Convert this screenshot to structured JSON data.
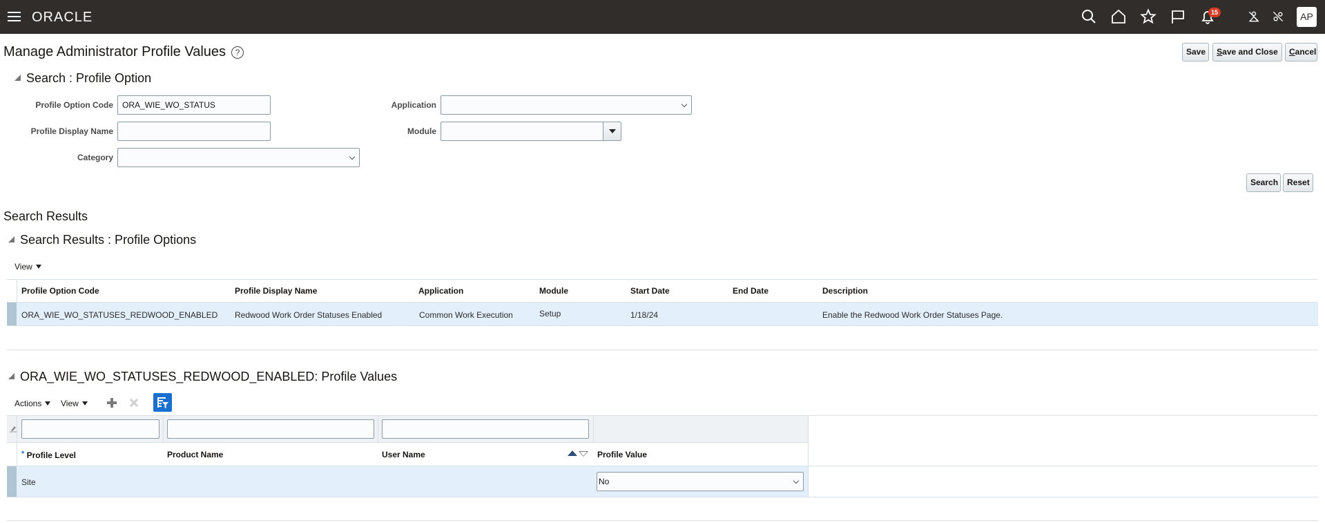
{
  "header": {
    "logo": "ORACLE",
    "notification_count": "15",
    "avatar_initials": "AP",
    "icons": [
      "menu-icon",
      "search-icon",
      "home-icon",
      "favorites-icon",
      "flag-icon",
      "notifications-icon",
      "accessibility-off-icon",
      "link-off-icon"
    ]
  },
  "page": {
    "title": "Manage Administrator Profile Values",
    "buttons": {
      "save": "Save",
      "save_and_close_accel": "S",
      "save_and_close_rest": "ave and Close",
      "cancel_accel": "C",
      "cancel_rest": "ancel"
    }
  },
  "search": {
    "title": "Search : Profile Option",
    "fields": {
      "profile_option_code_label": "Profile Option Code",
      "profile_option_code_value": "ORA_WIE_WO_STATUS",
      "profile_display_name_label": "Profile Display Name",
      "profile_display_name_value": "",
      "category_label": "Category",
      "category_value": "",
      "application_label": "Application",
      "application_value": "",
      "module_label": "Module",
      "module_value": ""
    },
    "search_button": "Search",
    "reset_button": "Reset"
  },
  "results": {
    "heading": "Search Results",
    "panel_title": "Search Results : Profile Options",
    "view_label": "View",
    "columns": [
      "Profile Option Code",
      "Profile Display Name",
      "Application",
      "Module",
      "Start Date",
      "End Date",
      "Description"
    ],
    "rows": [
      {
        "code": "ORA_WIE_WO_STATUSES_REDWOOD_ENABLED",
        "display_name": "Redwood Work Order Statuses Enabled",
        "application": "Common Work Execution",
        "module": "Setup",
        "start_date": "1/18/24",
        "end_date": "",
        "description": "Enable the Redwood Work Order Statuses Page."
      }
    ]
  },
  "values": {
    "panel_title": "ORA_WIE_WO_STATUSES_REDWOOD_ENABLED: Profile Values",
    "actions_label": "Actions",
    "view_label": "View",
    "required_mark": "*",
    "columns": [
      "Profile Level",
      "Product Name",
      "User Name",
      "Profile Value"
    ],
    "filters": [
      "",
      "",
      ""
    ],
    "rows": [
      {
        "profile_level": "Site",
        "product_name": "",
        "user_name": "",
        "profile_value": "No"
      }
    ]
  }
}
